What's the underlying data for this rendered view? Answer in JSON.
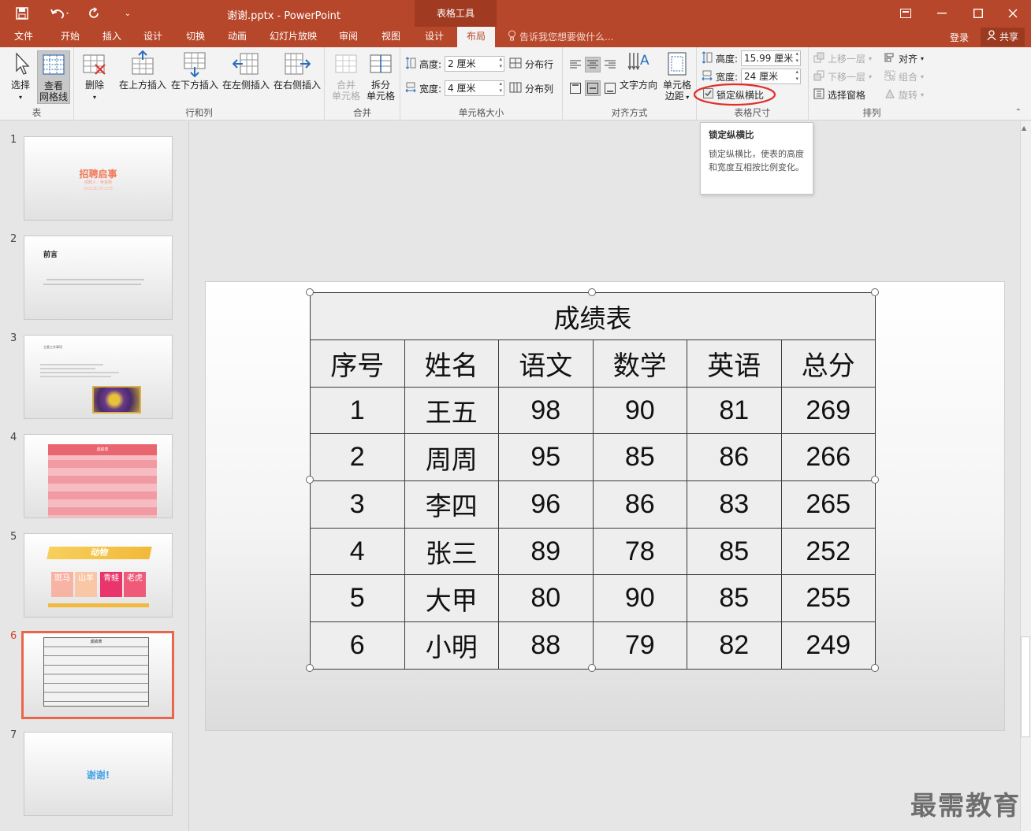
{
  "titlebar": {
    "doc_title": "谢谢.pptx - PowerPoint",
    "context_tools": "表格工具"
  },
  "tabs": [
    "文件",
    "开始",
    "插入",
    "设计",
    "切换",
    "动画",
    "幻灯片放映",
    "审阅",
    "视图",
    "设计",
    "布局"
  ],
  "active_tab": "布局",
  "tellme": "告诉我您想要做什么...",
  "account": {
    "login": "登录",
    "share": "共享"
  },
  "ribbon": {
    "table_group": {
      "label": "表",
      "select": "选择",
      "view_gridlines_1": "查看",
      "view_gridlines_2": "网格线"
    },
    "rows_cols_group": {
      "label": "行和列",
      "delete": "删除",
      "insert_above": "在上方插入",
      "insert_below": "在下方插入",
      "insert_left": "在左侧插入",
      "insert_right": "在右侧插入"
    },
    "merge_group": {
      "label": "合并",
      "merge_1": "合并",
      "merge_2": "单元格",
      "split_1": "拆分",
      "split_2": "单元格"
    },
    "cell_size_group": {
      "label": "单元格大小",
      "height_label": "高度:",
      "height_value": "2 厘米",
      "width_label": "宽度:",
      "width_value": "4 厘米",
      "distribute_rows": "分布行",
      "distribute_cols": "分布列"
    },
    "alignment_group": {
      "label": "对齐方式",
      "text_direction": "文字方向",
      "cell_margins_1": "单元格",
      "cell_margins_2": "边距"
    },
    "table_size_group": {
      "label": "表格尺寸",
      "height_label": "高度:",
      "height_value": "15.99 厘米",
      "width_label": "宽度:",
      "width_value": "24 厘米",
      "lock_ratio": "锁定纵横比",
      "lock_ratio_checked": true
    },
    "arrange_group": {
      "label": "排列",
      "bring_forward": "上移一层",
      "send_backward": "下移一层",
      "selection_pane": "选择窗格",
      "align": "对齐",
      "group": "组合",
      "rotate": "旋转"
    }
  },
  "tooltip": {
    "title": "锁定纵横比",
    "body": "锁定纵横比，使表的高度和宽度互相按比例变化。"
  },
  "slides": [
    {
      "num": "1",
      "title": "招聘启事",
      "sub1": "招聘人：吴金刚",
      "sub2": "2021年1月12日"
    },
    {
      "num": "2",
      "title": "前言"
    },
    {
      "num": "3",
      "title": "主要工作事项"
    },
    {
      "num": "4",
      "title": "成绩表"
    },
    {
      "num": "5",
      "title": "动物",
      "tiles": [
        "斑马",
        "山羊",
        "青蛙",
        "老虎"
      ]
    },
    {
      "num": "6",
      "title": "成绩表"
    },
    {
      "num": "7",
      "title": "谢谢!"
    }
  ],
  "active_slide": "6",
  "table": {
    "title": "成绩表",
    "headers": [
      "序号",
      "姓名",
      "语文",
      "数学",
      "英语",
      "总分"
    ],
    "rows": [
      [
        "1",
        "王五",
        "98",
        "90",
        "81",
        "269"
      ],
      [
        "2",
        "周周",
        "95",
        "85",
        "86",
        "266"
      ],
      [
        "3",
        "李四",
        "96",
        "86",
        "83",
        "265"
      ],
      [
        "4",
        "张三",
        "89",
        "78",
        "85",
        "252"
      ],
      [
        "5",
        "大甲",
        "80",
        "90",
        "85",
        "255"
      ],
      [
        "6",
        "小明",
        "88",
        "79",
        "82",
        "249"
      ]
    ]
  },
  "watermark": "最需教育",
  "colors": {
    "accent": "#b7472a",
    "tool_context": "#a03b22",
    "selected_slide": "#e8674a",
    "highlight_circle": "#e0302a"
  }
}
